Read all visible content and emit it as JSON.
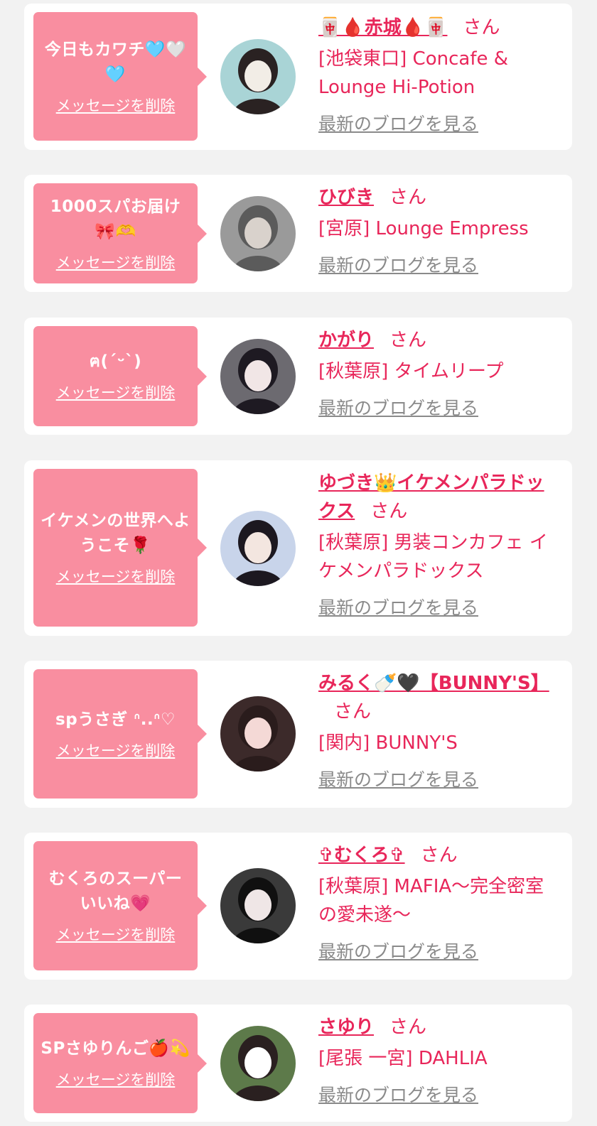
{
  "common": {
    "delete_label": "メッセージを削除",
    "san": "さん",
    "blog_label": "最新のブログを見る"
  },
  "items": [
    {
      "message": "今日もカワチ🩵🤍🩵",
      "name": "🀄🩸赤城🩸🀄",
      "shop": "[池袋東口] Concafe & Lounge Hi-Potion",
      "avatar_colors": [
        "#a9d4d6",
        "#f2ede6",
        "#2a2222"
      ]
    },
    {
      "message": "1000スパお届け🎀🫶",
      "name": "ひびき",
      "shop": "[宮原] Lounge Empress",
      "avatar_colors": [
        "#9a9a9a",
        "#d9d2cc",
        "#5b5b5b"
      ]
    },
    {
      "message": "ฅ(ˊᵕˋ)",
      "name": "かがり",
      "shop": "[秋葉原] タイムリープ",
      "avatar_colors": [
        "#6c6a70",
        "#f1e6e6",
        "#1e1a22"
      ]
    },
    {
      "message": "イケメンの世界へようこそ🌹",
      "name": "ゆづき👑イケメンパラドックス",
      "shop": "[秋葉原] 男装コンカフェ イケメンパラドックス",
      "avatar_colors": [
        "#c8d4ea",
        "#f3e6e0",
        "#1c1820"
      ]
    },
    {
      "message": "spうさぎ ᐢ..ᐢ♡",
      "name": "みるく🍼🖤【BUNNY'S】",
      "shop": "[関内] BUNNY'S",
      "avatar_colors": [
        "#3c2a2a",
        "#f4d9d6",
        "#2a1c1c"
      ]
    },
    {
      "message": "むくろのスーパーいいね💗",
      "name": "✞むくろ✞",
      "shop": "[秋葉原] MAFIA〜完全密室の愛未遂〜",
      "avatar_colors": [
        "#3a3a3a",
        "#efe6e6",
        "#101010"
      ]
    },
    {
      "message": "SPさゆりんご🍎💫",
      "name": "さゆり",
      "shop": "[尾張 一宮] DAHLIA",
      "avatar_colors": [
        "#5d7a4a",
        "#ffffff",
        "#2a2020"
      ]
    }
  ]
}
